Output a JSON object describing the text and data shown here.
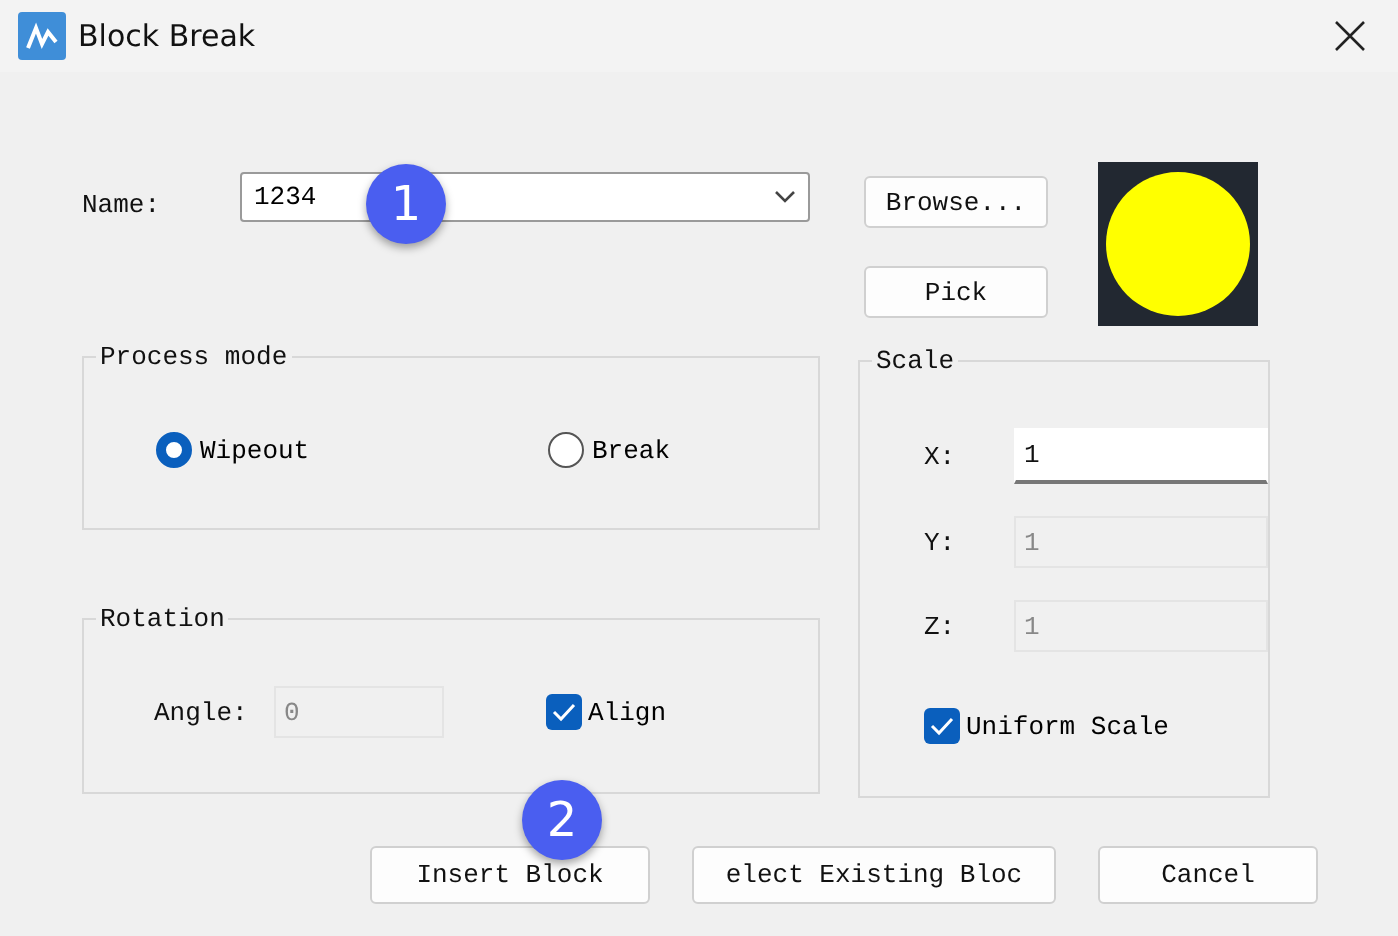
{
  "window": {
    "title": "Block Break"
  },
  "name_field": {
    "label": "Name:",
    "value": "1234"
  },
  "side_buttons": [
    "Browse...",
    "Pick"
  ],
  "preview": {
    "kind": "picture"
  },
  "process_mode": {
    "title": "Process mode",
    "options": [
      {
        "label": "Wipeout",
        "selected": true
      },
      {
        "label": "Break",
        "selected": false
      }
    ]
  },
  "rotation": {
    "title": "Rotation",
    "angle": {
      "label": "Angle:",
      "value": "0",
      "disabled": true
    },
    "align": {
      "label": "Align",
      "checked": true
    }
  },
  "scale": {
    "title": "Scale",
    "fields": [
      {
        "label": "X:",
        "value": "1",
        "disabled": false
      },
      {
        "label": "Y:",
        "value": "1",
        "disabled": true
      },
      {
        "label": "Z:",
        "value": "1",
        "disabled": true
      }
    ],
    "uniform": {
      "label": "Uniform Scale",
      "checked": true
    }
  },
  "buttons": [
    "Insert Block",
    "elect Existing Bloc",
    "Cancel"
  ],
  "callouts": [
    "1",
    "2"
  ]
}
